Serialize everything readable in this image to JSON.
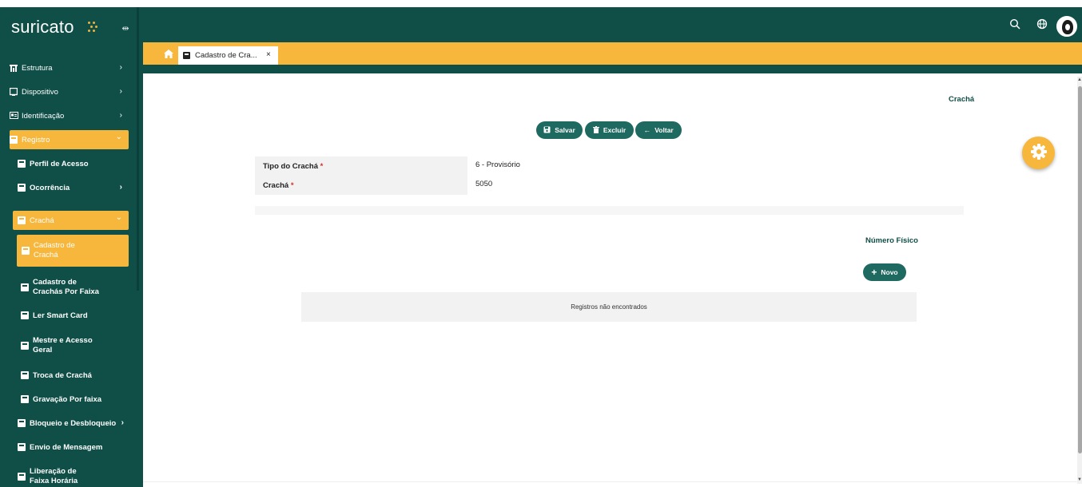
{
  "app": {
    "logo_text": "suricato",
    "brand_color": "#0f4f47",
    "accent_color": "#f6b73c"
  },
  "header": {
    "icons": [
      "search-icon",
      "globe-icon",
      "user-avatar"
    ]
  },
  "sidebar": {
    "items": [
      {
        "label": "Estrutura",
        "icon": "building-icon",
        "chevron": "›"
      },
      {
        "label": "Dispositivo",
        "icon": "device-icon",
        "chevron": "›"
      },
      {
        "label": "Identificação",
        "icon": "id-card-icon",
        "chevron": "›"
      },
      {
        "label": "Registro",
        "icon": "register-icon",
        "chevron": "⌄",
        "active": true
      },
      {
        "label": "Perfil de Acesso",
        "icon": "doc-icon"
      },
      {
        "label": "Ocorrência",
        "icon": "doc-icon",
        "chevron": "›"
      },
      {
        "label": "Crachá",
        "icon": "doc-icon",
        "chevron": "⌄",
        "active": true
      },
      {
        "label": "Cadastro de Crachá",
        "icon": "doc-icon",
        "active": true
      },
      {
        "label": "Cadastro de Crachás Por Faixa",
        "icon": "doc-icon"
      },
      {
        "label": "Ler Smart Card",
        "icon": "doc-icon"
      },
      {
        "label": "Mestre e Acesso Geral",
        "icon": "doc-icon"
      },
      {
        "label": "Troca de Crachá",
        "icon": "doc-icon"
      },
      {
        "label": "Gravação Por faixa",
        "icon": "doc-icon"
      },
      {
        "label": "Bloqueio e Desbloqueio",
        "icon": "doc-icon",
        "chevron": "›"
      },
      {
        "label": "Envio de Mensagem",
        "icon": "doc-icon"
      },
      {
        "label": "Liberação de Faixa Horária",
        "icon": "doc-icon"
      }
    ]
  },
  "tabs": {
    "active_label": "Cadastro de Cra...",
    "close": "×"
  },
  "main": {
    "section_title": "Crachá",
    "buttons": {
      "save": "Salvar",
      "delete": "Excluir",
      "back": "Voltar",
      "new": "Novo"
    },
    "form": {
      "tipo_label": "Tipo do Crachá",
      "tipo_value": "6 - Provisório",
      "cracha_label": "Crachá",
      "cracha_value": "5050",
      "required_mark": "*"
    },
    "subsection_title": "Número Físico",
    "empty_message": "Registros não encontrados"
  }
}
